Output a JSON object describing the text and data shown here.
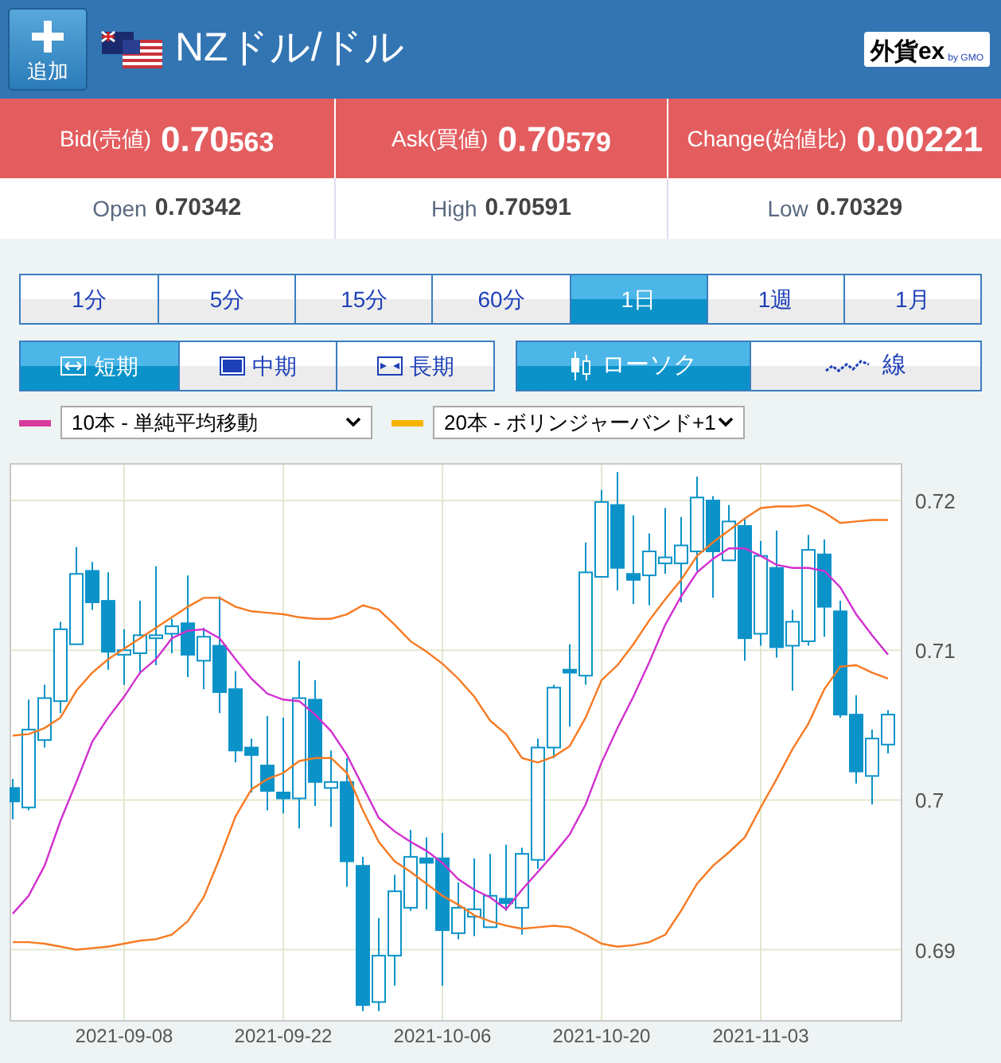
{
  "header": {
    "add_button": {
      "label": "追加"
    },
    "title": "NZドル/ドル",
    "logo": {
      "main": "外貨ex",
      "sub": "by GMO"
    }
  },
  "quotes": [
    {
      "label": "Bid(売値)",
      "main": "0.70",
      "tail": "563"
    },
    {
      "label": "Ask(買値)",
      "main": "0.70",
      "tail": "579"
    },
    {
      "label": "Change(始値比)",
      "main": "0.00221"
    }
  ],
  "stats": [
    {
      "label": "Open",
      "main": "0.70",
      "tail": "342"
    },
    {
      "label": "High",
      "main": "0.70",
      "tail": "591"
    },
    {
      "label": "Low",
      "main": "0.70",
      "tail": "329"
    }
  ],
  "periods": [
    {
      "label": "1分",
      "selected": false
    },
    {
      "label": "5分",
      "selected": false
    },
    {
      "label": "15分",
      "selected": false
    },
    {
      "label": "60分",
      "selected": false
    },
    {
      "label": "1日",
      "selected": true
    },
    {
      "label": "1週",
      "selected": false
    },
    {
      "label": "1月",
      "selected": false
    }
  ],
  "ranges": [
    {
      "kind": "short",
      "label": "短期",
      "selected": true
    },
    {
      "kind": "mid",
      "label": "中期",
      "selected": false
    },
    {
      "kind": "long",
      "label": "長期",
      "selected": false
    }
  ],
  "styles": [
    {
      "kind": "candle",
      "label": "ローソク",
      "selected": true
    },
    {
      "kind": "line",
      "label": "線",
      "selected": false
    }
  ],
  "indicators": [
    {
      "color": "#d63a9a",
      "value": "10本 - 単純平均移動"
    },
    {
      "color": "#f6b400",
      "value": "20本 - ボリンジャーバンド+1"
    }
  ],
  "chart": {
    "chart_data": {
      "type": "candlestick",
      "grid": true,
      "ylim": [
        0.6853,
        0.7225
      ],
      "categories": [
        null,
        null,
        null,
        null,
        null,
        null,
        null,
        "2021-09-08",
        null,
        null,
        null,
        null,
        null,
        null,
        null,
        null,
        null,
        "2021-09-22",
        null,
        null,
        null,
        null,
        null,
        null,
        null,
        null,
        null,
        "2021-10-06",
        null,
        null,
        null,
        null,
        null,
        null,
        null,
        null,
        null,
        "2021-10-20",
        null,
        null,
        null,
        null,
        null,
        null,
        null,
        null,
        null,
        "2021-11-03",
        null,
        null,
        null,
        null,
        null,
        null,
        null,
        null
      ],
      "yticks": [
        0.69,
        0.7,
        0.71,
        0.72
      ],
      "ohlc": [
        [
          0.7008,
          0.7014,
          0.6987,
          0.6999
        ],
        [
          0.6995,
          0.7067,
          0.6993,
          0.7047
        ],
        [
          0.704,
          0.7077,
          0.7035,
          0.7068
        ],
        [
          0.7066,
          0.7119,
          0.7058,
          0.7114
        ],
        [
          0.7104,
          0.7169,
          0.7104,
          0.7151
        ],
        [
          0.7153,
          0.7159,
          0.7127,
          0.7132
        ],
        [
          0.7133,
          0.7152,
          0.7087,
          0.7099
        ],
        [
          0.7097,
          0.7114,
          0.7077,
          0.71
        ],
        [
          0.7098,
          0.7133,
          0.7084,
          0.711
        ],
        [
          0.7108,
          0.7156,
          0.709,
          0.711
        ],
        [
          0.7111,
          0.7121,
          0.7098,
          0.7116
        ],
        [
          0.7118,
          0.715,
          0.7082,
          0.7097
        ],
        [
          0.7093,
          0.7115,
          0.7074,
          0.7109
        ],
        [
          0.7103,
          0.7136,
          0.7058,
          0.7072
        ],
        [
          0.7074,
          0.7086,
          0.7025,
          0.7033
        ],
        [
          0.7035,
          0.7041,
          0.7005,
          0.703
        ],
        [
          0.7023,
          0.7056,
          0.6993,
          0.7006
        ],
        [
          0.7005,
          0.7055,
          0.6991,
          0.7001
        ],
        [
          0.7001,
          0.7093,
          0.6981,
          0.7068
        ],
        [
          0.7067,
          0.708,
          0.6996,
          0.7012
        ],
        [
          0.7008,
          0.7033,
          0.6982,
          0.7012
        ],
        [
          0.7012,
          0.7028,
          0.6942,
          0.6959
        ],
        [
          0.6956,
          0.6962,
          0.6859,
          0.6863
        ],
        [
          0.6865,
          0.6921,
          0.6859,
          0.6896
        ],
        [
          0.6896,
          0.695,
          0.6876,
          0.6939
        ],
        [
          0.6928,
          0.698,
          0.6926,
          0.6962
        ],
        [
          0.6961,
          0.6975,
          0.6927,
          0.6958
        ],
        [
          0.6961,
          0.6978,
          0.6876,
          0.6913
        ],
        [
          0.6911,
          0.6945,
          0.6907,
          0.6928
        ],
        [
          0.6922,
          0.6961,
          0.6909,
          0.6927
        ],
        [
          0.6915,
          0.6964,
          0.6915,
          0.6936
        ],
        [
          0.6934,
          0.697,
          0.6926,
          0.6931
        ],
        [
          0.6928,
          0.6968,
          0.691,
          0.6964
        ],
        [
          0.696,
          0.7041,
          0.6954,
          0.7035
        ],
        [
          0.7035,
          0.7077,
          0.7028,
          0.7075
        ],
        [
          0.7087,
          0.7104,
          0.7049,
          0.7085
        ],
        [
          0.7083,
          0.7172,
          0.7077,
          0.7152
        ],
        [
          0.7149,
          0.7207,
          0.7149,
          0.7199
        ],
        [
          0.7197,
          0.7219,
          0.714,
          0.7155
        ],
        [
          0.7151,
          0.719,
          0.7131,
          0.7147
        ],
        [
          0.715,
          0.7178,
          0.713,
          0.7166
        ],
        [
          0.7158,
          0.7195,
          0.7151,
          0.7162
        ],
        [
          0.7158,
          0.7189,
          0.7132,
          0.717
        ],
        [
          0.7166,
          0.7216,
          0.7153,
          0.7202
        ],
        [
          0.72,
          0.7203,
          0.7135,
          0.7166
        ],
        [
          0.716,
          0.7197,
          0.716,
          0.7186
        ],
        [
          0.7183,
          0.7188,
          0.7093,
          0.7108
        ],
        [
          0.7111,
          0.7173,
          0.7103,
          0.7163
        ],
        [
          0.7155,
          0.718,
          0.7095,
          0.7102
        ],
        [
          0.7103,
          0.7127,
          0.7073,
          0.7119
        ],
        [
          0.7106,
          0.7177,
          0.7103,
          0.7167
        ],
        [
          0.7164,
          0.7174,
          0.7109,
          0.7129
        ],
        [
          0.7126,
          0.7133,
          0.7055,
          0.7057
        ],
        [
          0.7057,
          0.707,
          0.7011,
          0.7019
        ],
        [
          0.7016,
          0.7047,
          0.6997,
          0.7041
        ],
        [
          0.7037,
          0.706,
          0.7031,
          0.7057
        ]
      ],
      "series": [
        {
          "type": "line",
          "color": "#d12fd0",
          "values": [
            0.6924,
            0.6936,
            0.6956,
            0.6986,
            0.7012,
            0.7039,
            0.7055,
            0.7069,
            0.7085,
            0.7094,
            0.7108,
            0.7113,
            0.7114,
            0.7108,
            0.7094,
            0.7081,
            0.7071,
            0.7067,
            0.7066,
            0.7057,
            0.7046,
            0.703,
            0.7009,
            0.6988,
            0.6979,
            0.6972,
            0.6966,
            0.6958,
            0.6947,
            0.694,
            0.6935,
            0.6927,
            0.694,
            0.6952,
            0.6964,
            0.6977,
            0.6997,
            0.7025,
            0.7048,
            0.7069,
            0.7092,
            0.7117,
            0.7136,
            0.7152,
            0.7161,
            0.7168,
            0.7168,
            0.7163,
            0.7157,
            0.7155,
            0.7155,
            0.7153,
            0.7142,
            0.7124,
            0.711,
            0.7097
          ]
        },
        {
          "type": "line",
          "color": "#f77a22",
          "values": [
            0.7043,
            0.7044,
            0.7048,
            0.7055,
            0.7073,
            0.7085,
            0.7094,
            0.7101,
            0.7108,
            0.7115,
            0.7122,
            0.7129,
            0.7135,
            0.7135,
            0.7129,
            0.7126,
            0.7125,
            0.7124,
            0.7122,
            0.7121,
            0.7121,
            0.7124,
            0.713,
            0.7127,
            0.7117,
            0.7106,
            0.7099,
            0.7091,
            0.7081,
            0.7069,
            0.7053,
            0.7044,
            0.7028,
            0.7025,
            0.7029,
            0.7036,
            0.7055,
            0.708,
            0.709,
            0.7104,
            0.712,
            0.7134,
            0.7147,
            0.7163,
            0.7172,
            0.718,
            0.7188,
            0.7195,
            0.7196,
            0.7196,
            0.7197,
            0.7192,
            0.7185,
            0.7186,
            0.7187,
            0.7187
          ]
        },
        {
          "type": "line",
          "color": "#f77a22",
          "values": [
            0.6905,
            0.6905,
            0.6904,
            0.6902,
            0.69,
            0.6901,
            0.6902,
            0.6904,
            0.6906,
            0.6907,
            0.691,
            0.6919,
            0.6935,
            0.6961,
            0.6989,
            0.7007,
            0.7014,
            0.7018,
            0.7026,
            0.7028,
            0.7028,
            0.7018,
            0.6993,
            0.6972,
            0.6959,
            0.6952,
            0.6944,
            0.6936,
            0.693,
            0.6923,
            0.6919,
            0.6916,
            0.6914,
            0.6915,
            0.6916,
            0.6915,
            0.691,
            0.6904,
            0.6902,
            0.6903,
            0.6905,
            0.691,
            0.6926,
            0.6944,
            0.6956,
            0.6965,
            0.6975,
            0.6995,
            0.7014,
            0.7034,
            0.7051,
            0.7074,
            0.7089,
            0.709,
            0.7085,
            0.7081
          ]
        }
      ]
    }
  }
}
